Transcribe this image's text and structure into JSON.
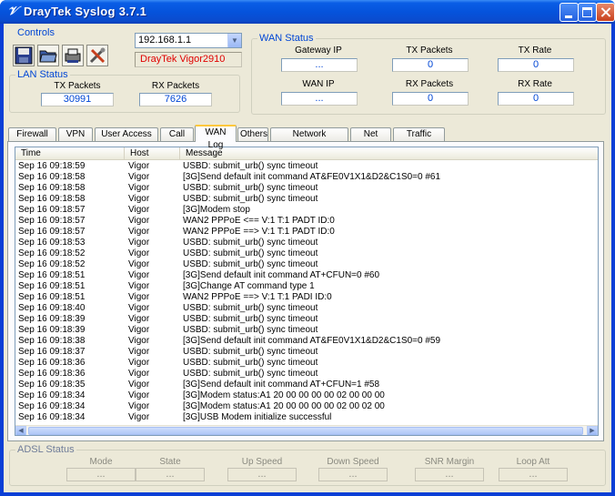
{
  "window": {
    "title": "DrayTek Syslog 3.7.1",
    "icon": "draytek-logo-icon"
  },
  "controls": {
    "title": "Controls",
    "tools": [
      "save-icon",
      "open-folder-icon",
      "network-printer-icon",
      "settings-tools-icon"
    ],
    "ip_value": "192.168.1.1",
    "model": "DrayTek Vigor2910"
  },
  "lan_status": {
    "title": "LAN Status",
    "tx_label": "TX Packets",
    "tx_value": "30991",
    "rx_label": "RX Packets",
    "rx_value": "7626"
  },
  "wan_status": {
    "title": "WAN Status",
    "gateway_ip_label": "Gateway IP",
    "gateway_ip_value": "...",
    "tx_packets_label": "TX Packets",
    "tx_packets_value": "0",
    "tx_rate_label": "TX Rate",
    "tx_rate_value": "0",
    "wan_ip_label": "WAN IP",
    "wan_ip_value": "...",
    "rx_packets_label": "RX Packets",
    "rx_packets_value": "0",
    "rx_rate_label": "RX Rate",
    "rx_rate_value": "0"
  },
  "tabs": [
    "Firewall Log",
    "VPN Log",
    "User Access Log",
    "Call Log",
    "WAN Log",
    "Others",
    "Network Information",
    "Net State",
    "Traffic Graph"
  ],
  "active_tab": "WAN Log",
  "log_table": {
    "columns": [
      "Time",
      "Host",
      "Message"
    ],
    "rows": [
      [
        "Sep 16 09:18:59",
        "Vigor",
        "USBD: submit_urb() sync timeout"
      ],
      [
        "Sep 16 09:18:58",
        "Vigor",
        "[3G]Send default init command AT&FE0V1X1&D2&C1S0=0 #61"
      ],
      [
        "Sep 16 09:18:58",
        "Vigor",
        "USBD: submit_urb() sync timeout"
      ],
      [
        "Sep 16 09:18:58",
        "Vigor",
        "USBD: submit_urb() sync timeout"
      ],
      [
        "Sep 16 09:18:57",
        "Vigor",
        "[3G]Modem stop"
      ],
      [
        "Sep 16 09:18:57",
        "Vigor",
        "WAN2 PPPoE <== V:1 T:1 PADT ID:0"
      ],
      [
        "Sep 16 09:18:57",
        "Vigor",
        "WAN2 PPPoE ==> V:1 T:1 PADT ID:0"
      ],
      [
        "Sep 16 09:18:53",
        "Vigor",
        "USBD: submit_urb() sync timeout"
      ],
      [
        "Sep 16 09:18:52",
        "Vigor",
        "USBD: submit_urb() sync timeout"
      ],
      [
        "Sep 16 09:18:52",
        "Vigor",
        "USBD: submit_urb() sync timeout"
      ],
      [
        "Sep 16 09:18:51",
        "Vigor",
        "[3G]Send default init command AT+CFUN=0 #60"
      ],
      [
        "Sep 16 09:18:51",
        "Vigor",
        "[3G]Change AT command type 1"
      ],
      [
        "Sep 16 09:18:51",
        "Vigor",
        "WAN2 PPPoE ==> V:1 T:1 PADI ID:0"
      ],
      [
        "Sep 16 09:18:40",
        "Vigor",
        "USBD: submit_urb() sync timeout"
      ],
      [
        "Sep 16 09:18:39",
        "Vigor",
        "USBD: submit_urb() sync timeout"
      ],
      [
        "Sep 16 09:18:39",
        "Vigor",
        "USBD: submit_urb() sync timeout"
      ],
      [
        "Sep 16 09:18:38",
        "Vigor",
        "[3G]Send default init command AT&FE0V1X1&D2&C1S0=0 #59"
      ],
      [
        "Sep 16 09:18:37",
        "Vigor",
        "USBD: submit_urb() sync timeout"
      ],
      [
        "Sep 16 09:18:36",
        "Vigor",
        "USBD: submit_urb() sync timeout"
      ],
      [
        "Sep 16 09:18:36",
        "Vigor",
        "USBD: submit_urb() sync timeout"
      ],
      [
        "Sep 16 09:18:35",
        "Vigor",
        "[3G]Send default init command AT+CFUN=1 #58"
      ],
      [
        "Sep 16 09:18:34",
        "Vigor",
        "[3G]Modem status:A1 20 00 00 00 00 02 00 00 00"
      ],
      [
        "Sep 16 09:18:34",
        "Vigor",
        "[3G]Modem status:A1 20 00 00 00 00 02 00 02 00"
      ],
      [
        "Sep 16 09:18:34",
        "Vigor",
        "[3G]USB Modem initialize successful"
      ]
    ]
  },
  "adsl_status": {
    "title": "ADSL Status",
    "fields": [
      {
        "label": "Mode",
        "value": "..."
      },
      {
        "label": "State",
        "value": "..."
      },
      {
        "label": "Up Speed",
        "value": "..."
      },
      {
        "label": "Down Speed",
        "value": "..."
      },
      {
        "label": "SNR Margin",
        "value": "..."
      },
      {
        "label": "Loop Att",
        "value": "..."
      }
    ]
  },
  "colors": {
    "group_title": "#0046d5",
    "model_text": "#e00000",
    "value_text": "#0046d5",
    "titlebar": "#0553dc"
  }
}
